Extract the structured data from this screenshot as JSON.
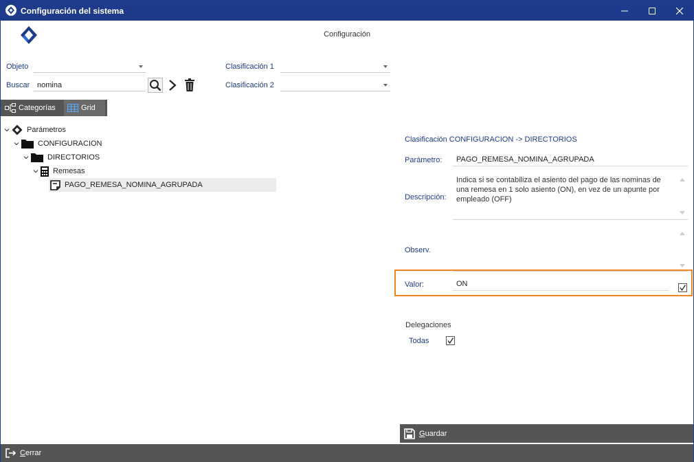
{
  "window": {
    "title": "Configuración del sistema"
  },
  "page": {
    "title": "Configuración"
  },
  "filters": {
    "objeto_label": "Objeto",
    "objeto_value": "",
    "buscar_label": "Buscar",
    "buscar_value": "nomina",
    "clasificacion1_label": "Clasificación 1",
    "clasificacion1_value": "",
    "clasificacion2_label": "Clasificación 2",
    "clasificacion2_value": ""
  },
  "toolbar": {
    "search_icon": "search-icon",
    "next_icon": "chevron-right-icon",
    "delete_icon": "trash-icon"
  },
  "tabs": [
    {
      "label": "Categorías",
      "icon": "hierarchy-icon"
    },
    {
      "label": "Grid",
      "icon": "grid-icon"
    }
  ],
  "tree": [
    {
      "label": "Parámetros",
      "icon": "logo-icon",
      "level": 0
    },
    {
      "label": "CONFIGURACION",
      "icon": "folder-icon",
      "level": 1
    },
    {
      "label": "DIRECTORIOS",
      "icon": "folder-icon",
      "level": 2
    },
    {
      "label": "Remesas",
      "icon": "calculator-icon",
      "level": 3
    },
    {
      "label": "PAGO_REMESA_NOMINA_AGRUPADA",
      "icon": "note-icon",
      "level": 4
    }
  ],
  "detail": {
    "heading": "Clasificación CONFIGURACION -> DIRECTORIOS",
    "parametro_label": "Parámetro:",
    "parametro_value": "PAGO_REMESA_NOMINA_AGRUPADA",
    "descripcion_label": "Descripción:",
    "descripcion_value": "Indica si se contabiliza el asiento del pago de las nominas de una remesa en 1 solo asiento (ON), en vez de un apunte por empleado (OFF)",
    "observ_label": "Observ.",
    "observ_value": "",
    "valor_label": "Valor:",
    "valor_value": "ON",
    "valor_checked": true,
    "delegaciones_label": "Delegaciones",
    "todas_label": "Todas",
    "todas_checked": true,
    "highlight_color": "#f0851b"
  },
  "buttons": {
    "guardar": "Guardar",
    "cerrar": "Cerrar"
  },
  "colors": {
    "titlebar": "#1e3a8a",
    "label": "#1e3a8a",
    "bar": "#555555"
  }
}
